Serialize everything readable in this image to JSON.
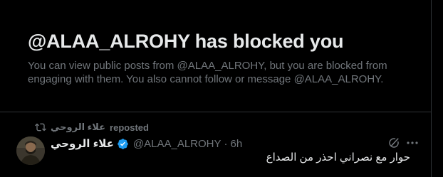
{
  "blocked_notice": {
    "title": "@ALAA_ALROHY has blocked you",
    "description": "You can view public posts from @ALAA_ALROHY, but you are blocked from engaging with them. You also cannot follow or message @ALAA_ALROHY."
  },
  "repost": {
    "reposter_name": "علاء الروحي",
    "label": "reposted",
    "icon": "repost-icon"
  },
  "tweet": {
    "display_name": "علاء الروحي",
    "handle": "@ALAA_ALROHY",
    "separator": "·",
    "time": "6h",
    "text": "حوار مع نصراني احذر من الصداع",
    "icons": [
      "verified-badge-icon",
      "grok-icon",
      "more-icon"
    ]
  },
  "colors": {
    "background": "#000000",
    "primary_text": "#e7e9ea",
    "secondary_text": "#71767b",
    "border": "#2f3336",
    "verified_badge": "#1d9bf0"
  }
}
